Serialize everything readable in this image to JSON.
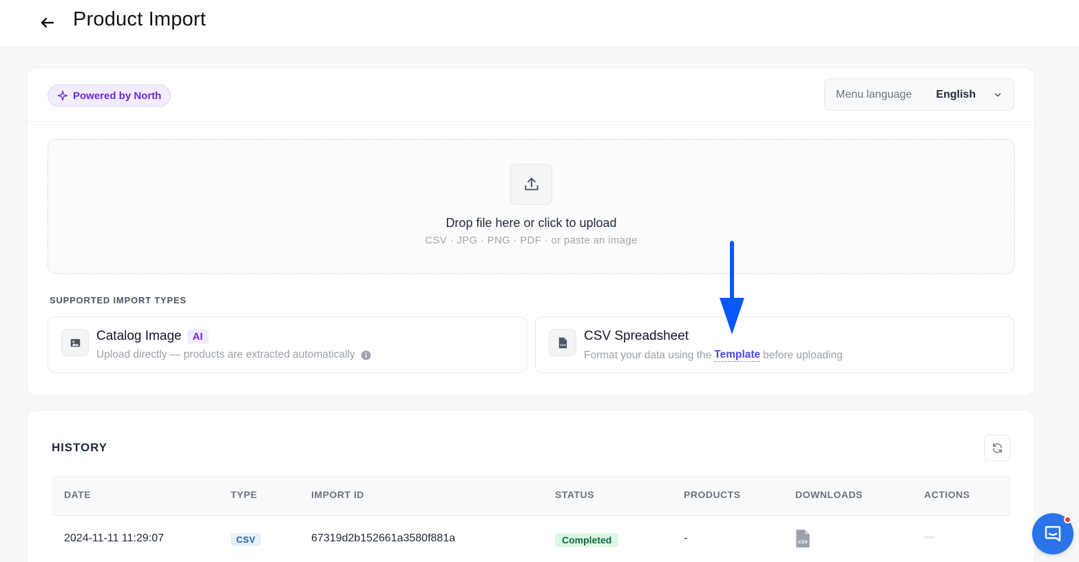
{
  "header": {
    "title": "Product Import"
  },
  "powered": {
    "label": "Powered by North"
  },
  "language": {
    "label": "Menu language",
    "value": "English"
  },
  "dropzone": {
    "title": "Drop file here or click to upload",
    "subtitle": "CSV · JPG · PNG · PDF · or paste an image"
  },
  "import_types": {
    "label": "SUPPORTED IMPORT TYPES",
    "catalog": {
      "title": "Catalog Image",
      "badge": "AI",
      "subtitle": "Upload directly — products are extracted automatically"
    },
    "csv": {
      "title": "CSV Spreadsheet",
      "subtitle_before": "Format your data using the",
      "link": "Template",
      "subtitle_after": "before uploading"
    }
  },
  "history": {
    "title": "HISTORY",
    "columns": [
      "DATE",
      "TYPE",
      "IMPORT ID",
      "STATUS",
      "PRODUCTS",
      "DOWNLOADS",
      "ACTIONS"
    ],
    "rows": [
      {
        "date": "2024-11-11 11:29:07",
        "type": "CSV",
        "import_id": "67319d2b152661a3580f881a",
        "status": "Completed",
        "products": "-",
        "download_icon": "csv-file-icon",
        "actions": "—"
      }
    ]
  },
  "colors": {
    "accent_purple": "#6d28d9",
    "link": "#4f46e5",
    "annotation_arrow": "#0b57ff",
    "chat_button": "#2a73e8",
    "status_green": "#11693a"
  },
  "icons": {
    "back": "arrow-left-icon",
    "sparkle": "sparkle-icon",
    "chevron": "chevron-down-icon",
    "upload": "upload-icon",
    "image": "image-icon",
    "csv": "csv-file-icon",
    "info": "info-icon",
    "refresh": "refresh-icon",
    "chat": "chat-icon"
  }
}
